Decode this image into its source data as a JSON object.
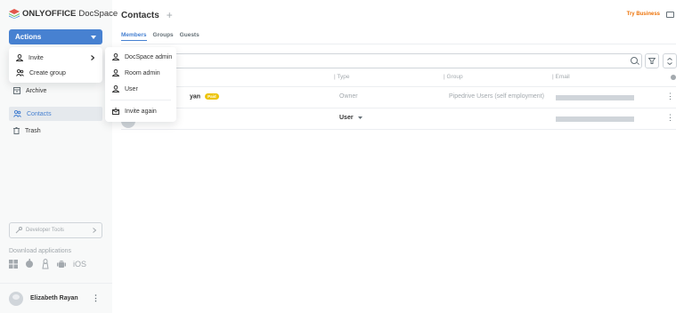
{
  "app": {
    "logo_brand": "ONLYOFFICE",
    "logo_product": "DocSpace"
  },
  "sidebar": {
    "actions_label": "Actions",
    "items": [
      {
        "label": "Archive"
      },
      {
        "label": "Contacts"
      },
      {
        "label": "Trash"
      }
    ],
    "dev_tools_label": "Developer Tools",
    "download_label": "Download applications",
    "download_ios_label": "iOS",
    "user_name": "Elizabeth Rayan"
  },
  "actions_menu": {
    "items": [
      {
        "label": "Invite"
      },
      {
        "label": "Create group"
      }
    ]
  },
  "invite_menu": {
    "items": [
      {
        "label": "DocSpace admin"
      },
      {
        "label": "Room admin"
      },
      {
        "label": "User"
      },
      {
        "label": "Invite again"
      }
    ]
  },
  "header": {
    "title": "Contacts",
    "try_business": "Try Business"
  },
  "tabs": [
    {
      "label": "Members"
    },
    {
      "label": "Groups"
    },
    {
      "label": "Guests"
    }
  ],
  "table": {
    "columns": {
      "type": "Type",
      "group": "Group",
      "email": "Email"
    },
    "rows": [
      {
        "name": "yan",
        "badge": "Paid",
        "type": "Owner",
        "group": "Pipedrive Users (self employment)"
      },
      {
        "name": "",
        "type": "User"
      }
    ]
  },
  "colors": {
    "accent": "#4781d1",
    "try_business": "#ed7309",
    "paid_badge": "#edc409"
  }
}
